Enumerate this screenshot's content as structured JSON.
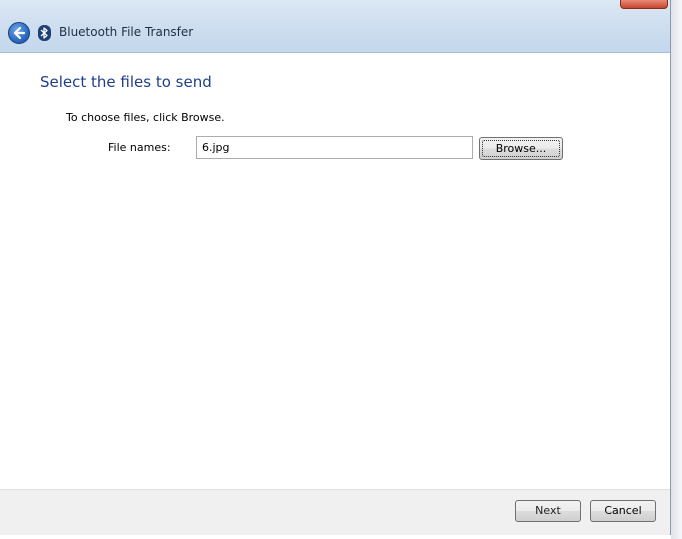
{
  "window": {
    "title": "Bluetooth File Transfer"
  },
  "page": {
    "heading": "Select the files to send",
    "instruction": "To choose files, click Browse."
  },
  "form": {
    "file_names_label": "File names:",
    "file_names_value": "6.jpg",
    "browse_label": "Browse..."
  },
  "footer": {
    "next_label": "Next",
    "cancel_label": "Cancel"
  },
  "icons": {
    "back": "back-arrow-icon",
    "bluetooth": "bluetooth-icon",
    "close": "close-icon"
  },
  "colors": {
    "heading": "#1e3f8a",
    "title_bar": "#cfdff0",
    "footer": "#f0f0f0"
  }
}
